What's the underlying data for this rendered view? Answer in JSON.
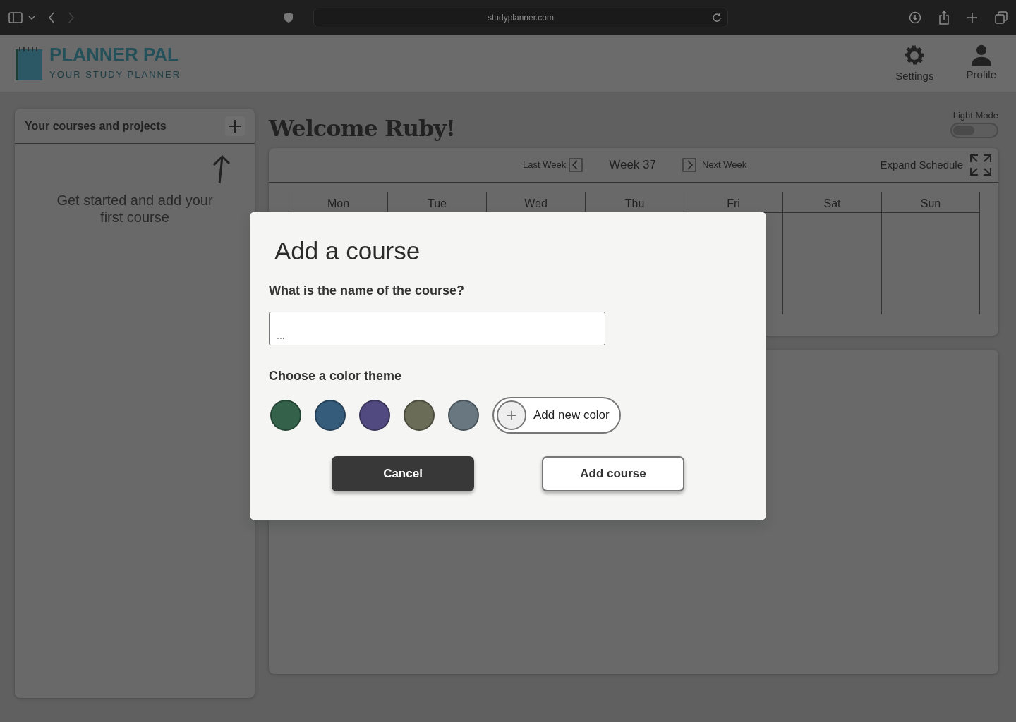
{
  "browser": {
    "url": "studyplanner.com"
  },
  "header": {
    "brand": "PLANNER PAL",
    "tagline": "YOUR STUDY PLANNER",
    "nav": [
      {
        "kind": "settings",
        "label": "Settings"
      },
      {
        "kind": "profile",
        "label": "Profile"
      }
    ]
  },
  "sidebar": {
    "title": "Your courses and projects",
    "empty_text": "Get started and add your first course"
  },
  "main": {
    "greeting": "Welcome Ruby!",
    "light_mode": {
      "label": "Light Mode",
      "on": false
    },
    "schedule": {
      "last_week": "Last Week",
      "week": "Week 37",
      "next_week": "Next Week",
      "expand": "Expand Schedule",
      "days": [
        "Mon",
        "Tue",
        "Wed",
        "Thu",
        "Fri",
        "Sat",
        "Sun"
      ]
    }
  },
  "modal": {
    "title": "Add a course",
    "name_label": "What is the name of the course?",
    "name_field": {
      "placeholder": "..."
    },
    "color_label": "Choose a color theme",
    "colors": [
      {
        "color": "#33614a",
        "selected": false
      },
      {
        "color": "#365c7b",
        "selected": false
      },
      {
        "color": "#514a80",
        "selected": false
      },
      {
        "color": "#6a6c58",
        "selected": false
      },
      {
        "color": "#687780",
        "selected": false
      }
    ],
    "add_color": "Add new color",
    "cancel": "Cancel",
    "submit": "Add course"
  }
}
